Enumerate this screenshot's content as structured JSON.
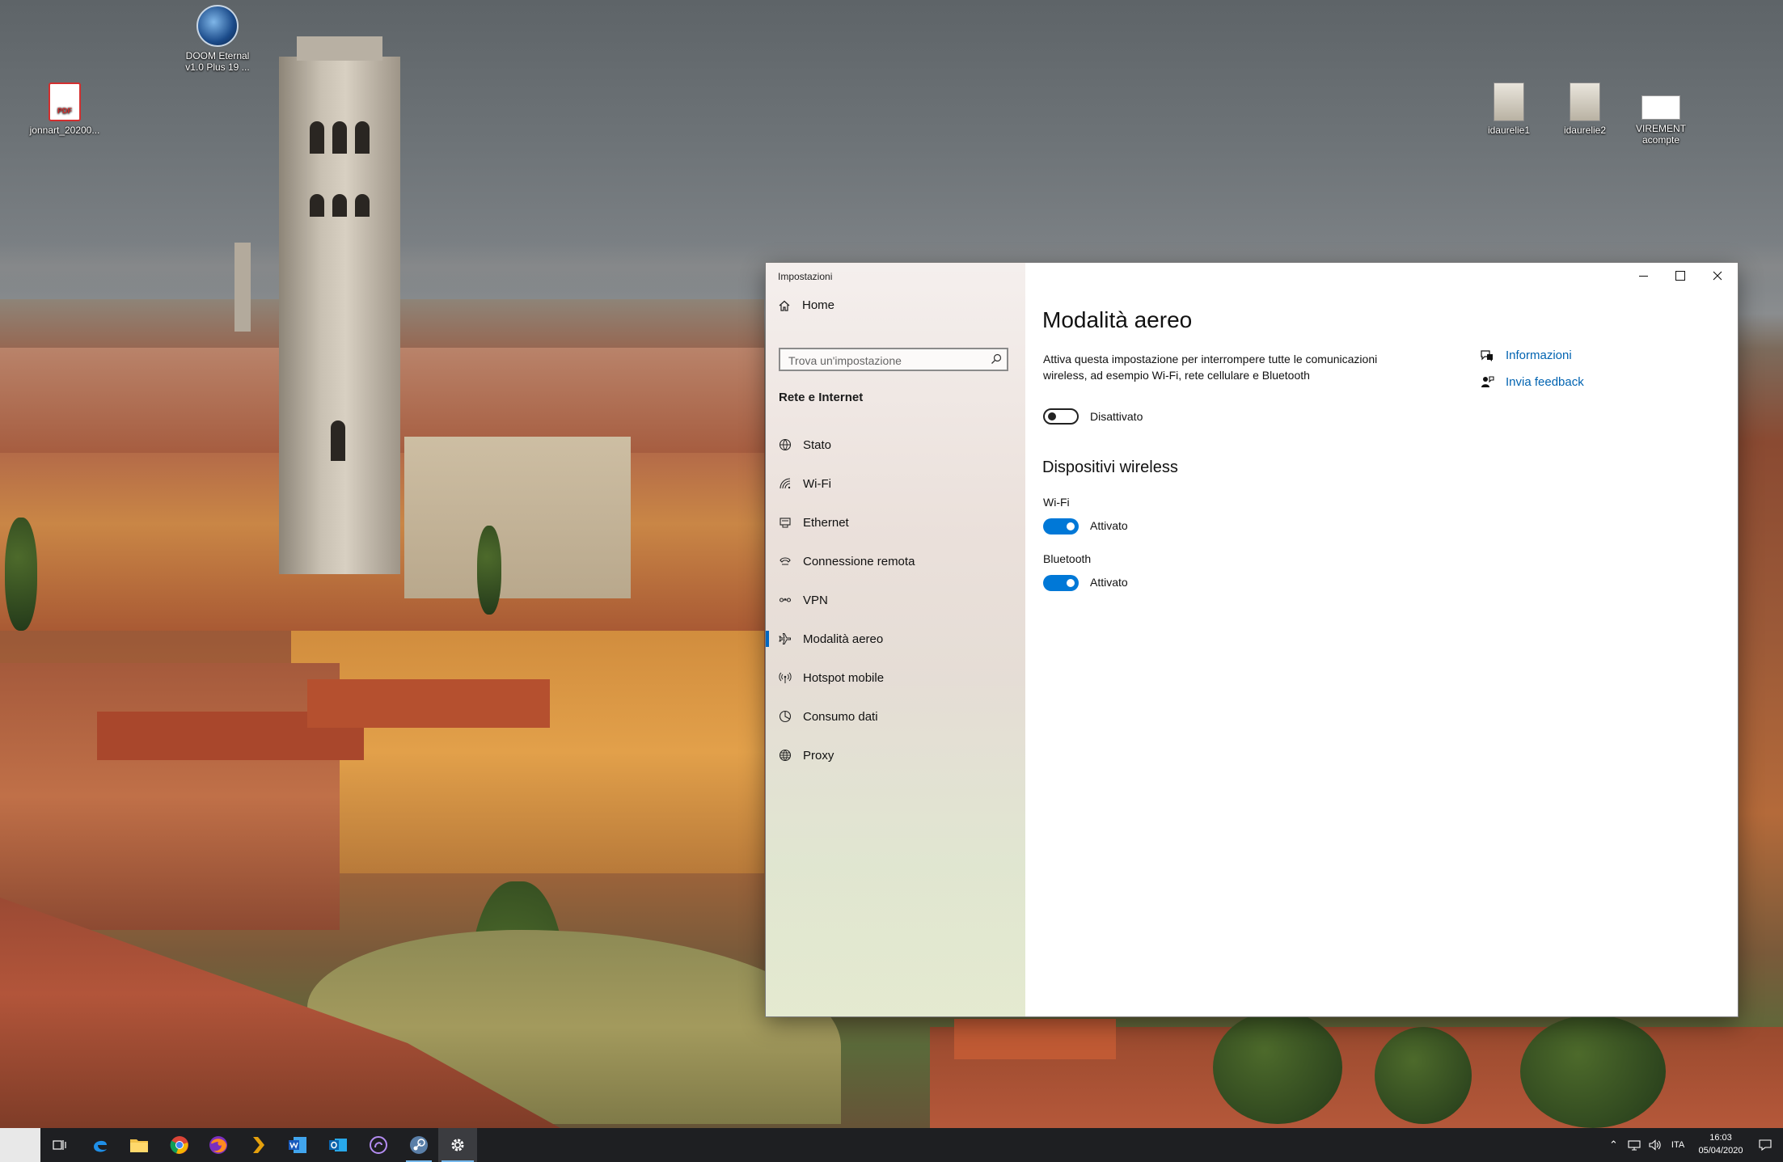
{
  "desktop": {
    "icons": [
      {
        "label": "jonnart_20200...",
        "kind": "pdf",
        "pdf_text": "PDF"
      },
      {
        "label": "DOOM Eternal v1.0 Plus 19 ...",
        "kind": "game"
      },
      {
        "label": "idaurelie1",
        "kind": "image"
      },
      {
        "label": "idaurelie2",
        "kind": "image"
      },
      {
        "label": "VIREMENT acompte",
        "kind": "image"
      }
    ]
  },
  "window": {
    "title": "Impostazioni",
    "controls": {
      "minimize": "minimize-icon",
      "maximize": "maximize-icon",
      "close": "close-icon"
    }
  },
  "sidebar": {
    "home_label": "Home",
    "search_placeholder": "Trova un'impostazione",
    "section_label": "Rete e Internet",
    "items": [
      {
        "label": "Stato",
        "icon": "globe-status-icon"
      },
      {
        "label": "Wi-Fi",
        "icon": "wifi-icon"
      },
      {
        "label": "Ethernet",
        "icon": "ethernet-icon"
      },
      {
        "label": "Connessione remota",
        "icon": "dialup-icon"
      },
      {
        "label": "VPN",
        "icon": "vpn-icon"
      },
      {
        "label": "Modalità aereo",
        "icon": "airplane-icon",
        "active": true
      },
      {
        "label": "Hotspot mobile",
        "icon": "hotspot-icon"
      },
      {
        "label": "Consumo dati",
        "icon": "data-usage-icon"
      },
      {
        "label": "Proxy",
        "icon": "globe-icon"
      }
    ]
  },
  "content": {
    "title": "Modalità aereo",
    "description": "Attiva questa impostazione per interrompere tutte le comunicazioni wireless, ad esempio Wi-Fi, rete cellulare e Bluetooth",
    "airplane_toggle": {
      "state": "off",
      "label": "Disattivato"
    },
    "wireless_heading": "Dispositivi wireless",
    "wifi": {
      "label": "Wi-Fi",
      "state": "on",
      "toggle_label": "Attivato"
    },
    "bluetooth": {
      "label": "Bluetooth",
      "state": "on",
      "toggle_label": "Attivato"
    },
    "links": [
      {
        "label": "Informazioni",
        "icon": "help-chat-icon"
      },
      {
        "label": "Invia feedback",
        "icon": "feedback-icon"
      }
    ],
    "accent_color": "#0078d7",
    "link_color": "#0063b1"
  },
  "taskbar": {
    "apps": [
      "task-view-icon",
      "edge-icon",
      "file-explorer-icon",
      "chrome-icon",
      "firefox-icon",
      "plex-icon",
      "word-icon",
      "outlook-icon",
      "app-icon",
      "steam-icon",
      "settings-icon"
    ],
    "language": "ITA",
    "time": "16:03",
    "date": "05/04/2020"
  }
}
